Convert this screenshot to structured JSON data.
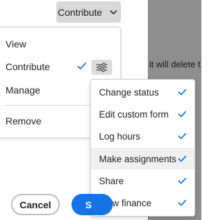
{
  "overlay": {
    "text": "it will delete t"
  },
  "trigger": {
    "label": "Contribute",
    "icon": "chevron-down-icon"
  },
  "menu": {
    "items": [
      {
        "label": "View"
      },
      {
        "label": "Contribute",
        "selected": true
      },
      {
        "label": "Manage"
      },
      {
        "label": "Remove"
      }
    ],
    "settings_icon": "sliders-icon"
  },
  "submenu": {
    "items": [
      {
        "label": "Change status",
        "checked": true
      },
      {
        "label": "Edit custom form",
        "checked": true
      },
      {
        "label": "Log hours",
        "checked": true
      },
      {
        "label": "Make assignments",
        "checked": true,
        "highlighted": true
      },
      {
        "label": "Share",
        "checked": true
      },
      {
        "label": "View finance",
        "checked": true
      }
    ]
  },
  "footer": {
    "cancel_label": "Cancel",
    "primary_label": "S"
  },
  "colors": {
    "accent": "#1473e6",
    "check": "#1473e6",
    "overlay": "#8e8e8e"
  }
}
